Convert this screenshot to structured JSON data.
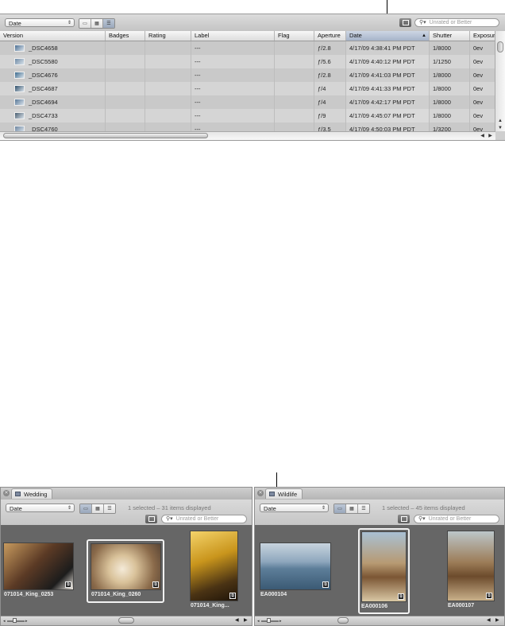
{
  "top_browser": {
    "sort_popup": "Date",
    "search_placeholder": "Unrated or Better",
    "columns": [
      "Version",
      "Badges",
      "Rating",
      "Label",
      "Flag",
      "Aperture",
      "Date",
      "Shutter",
      "Exposure"
    ],
    "rows": [
      {
        "version": "_DSC4658",
        "label": "---",
        "aperture": "ƒ/2.8",
        "date": "4/17/09 4:38:41 PM PDT",
        "shutter": "1/8000",
        "exposure": "0ev"
      },
      {
        "version": "_DSC5580",
        "label": "---",
        "aperture": "ƒ/5.6",
        "date": "4/17/09 4:40:12 PM PDT",
        "shutter": "1/1250",
        "exposure": "0ev"
      },
      {
        "version": "_DSC4676",
        "label": "---",
        "aperture": "ƒ/2.8",
        "date": "4/17/09 4:41:03 PM PDT",
        "shutter": "1/8000",
        "exposure": "0ev"
      },
      {
        "version": "_DSC4687",
        "label": "---",
        "aperture": "ƒ/4",
        "date": "4/17/09 4:41:33 PM PDT",
        "shutter": "1/8000",
        "exposure": "0ev"
      },
      {
        "version": "_DSC4694",
        "label": "---",
        "aperture": "ƒ/4",
        "date": "4/17/09 4:42:17 PM PDT",
        "shutter": "1/8000",
        "exposure": "0ev"
      },
      {
        "version": "_DSC4733",
        "label": "---",
        "aperture": "ƒ/9",
        "date": "4/17/09 4:45:07 PM PDT",
        "shutter": "1/8000",
        "exposure": "0ev"
      },
      {
        "version": "_DSC4760",
        "label": "---",
        "aperture": "ƒ/3.5",
        "date": "4/17/09 4:50:03 PM PDT",
        "shutter": "1/3200",
        "exposure": "0ev"
      }
    ]
  },
  "wedding_pane": {
    "tab_label": "Wedding",
    "sort_popup": "Date",
    "status": "1 selected – 31 items displayed",
    "search_placeholder": "Unrated or Better",
    "photos": [
      {
        "caption": "071014_King_0253",
        "color": "#8a5a3a"
      },
      {
        "caption": "071014_King_0260",
        "color": "#d8c3a0"
      },
      {
        "caption": "071014_King...",
        "color": "#c99a2a"
      }
    ]
  },
  "wildlife_pane": {
    "tab_label": "Wildlife",
    "sort_popup": "Date",
    "status": "1 selected – 45 items displayed",
    "search_placeholder": "Unrated or Better",
    "photos": [
      {
        "caption": "EA000104",
        "color": "#7a90a8"
      },
      {
        "caption": "EA000106",
        "color": "#8c6a48"
      },
      {
        "caption": "EA000107",
        "color": "#9a7c5a"
      }
    ]
  }
}
